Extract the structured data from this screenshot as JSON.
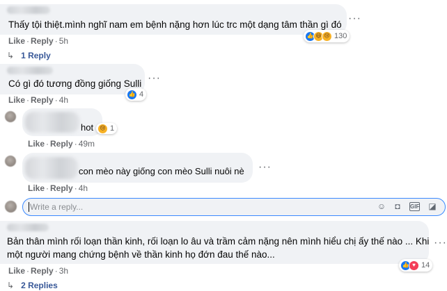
{
  "comments": [
    {
      "text": "Thấy tội thiệt.mình nghĩ nam em bệnh nặng hơn lúc trc một dạng tâm thần gì đó",
      "actions": {
        "like": "Like",
        "reply": "Reply",
        "time": "5h"
      },
      "reactions": {
        "icons": [
          "like-icon",
          "haha-icon",
          "sad-icon"
        ],
        "count": "130"
      },
      "replies_link": "1 Reply"
    },
    {
      "text": "Có gì đó tương đồng giống Sulli",
      "actions": {
        "like": "Like",
        "reply": "Reply",
        "time": "4h"
      },
      "reactions": {
        "icons": [
          "like-icon"
        ],
        "count": "4"
      },
      "replies": [
        {
          "text": "hot",
          "actions": {
            "like": "Like",
            "reply": "Reply",
            "time": "49m"
          },
          "reactions": {
            "icons": [
              "sad-icon"
            ],
            "count": "1"
          }
        },
        {
          "text": "con mèo này giống con mèo Sulli nuôi nè",
          "actions": {
            "like": "Like",
            "reply": "Reply",
            "time": "4h"
          }
        }
      ],
      "reply_input": {
        "placeholder": "Write a reply..."
      }
    },
    {
      "text_line1": "Bản thân mình rối loạn thần kinh, rối loạn lo âu và trầm cảm nặng nên mình hiểu chị ấy thế nào ... Khi",
      "text_line2": "một người mang chứng bệnh về thần kinh họ đớn đau thế nào...",
      "actions": {
        "like": "Like",
        "reply": "Reply",
        "time": "3h"
      },
      "reactions": {
        "icons": [
          "like-icon",
          "love-icon"
        ],
        "count": "14"
      },
      "replies_link": "2 Replies"
    }
  ],
  "colors": {
    "link": "#385898",
    "meta": "#65676b",
    "bubble": "#f0f2f5",
    "focus": "#3a89ff"
  }
}
